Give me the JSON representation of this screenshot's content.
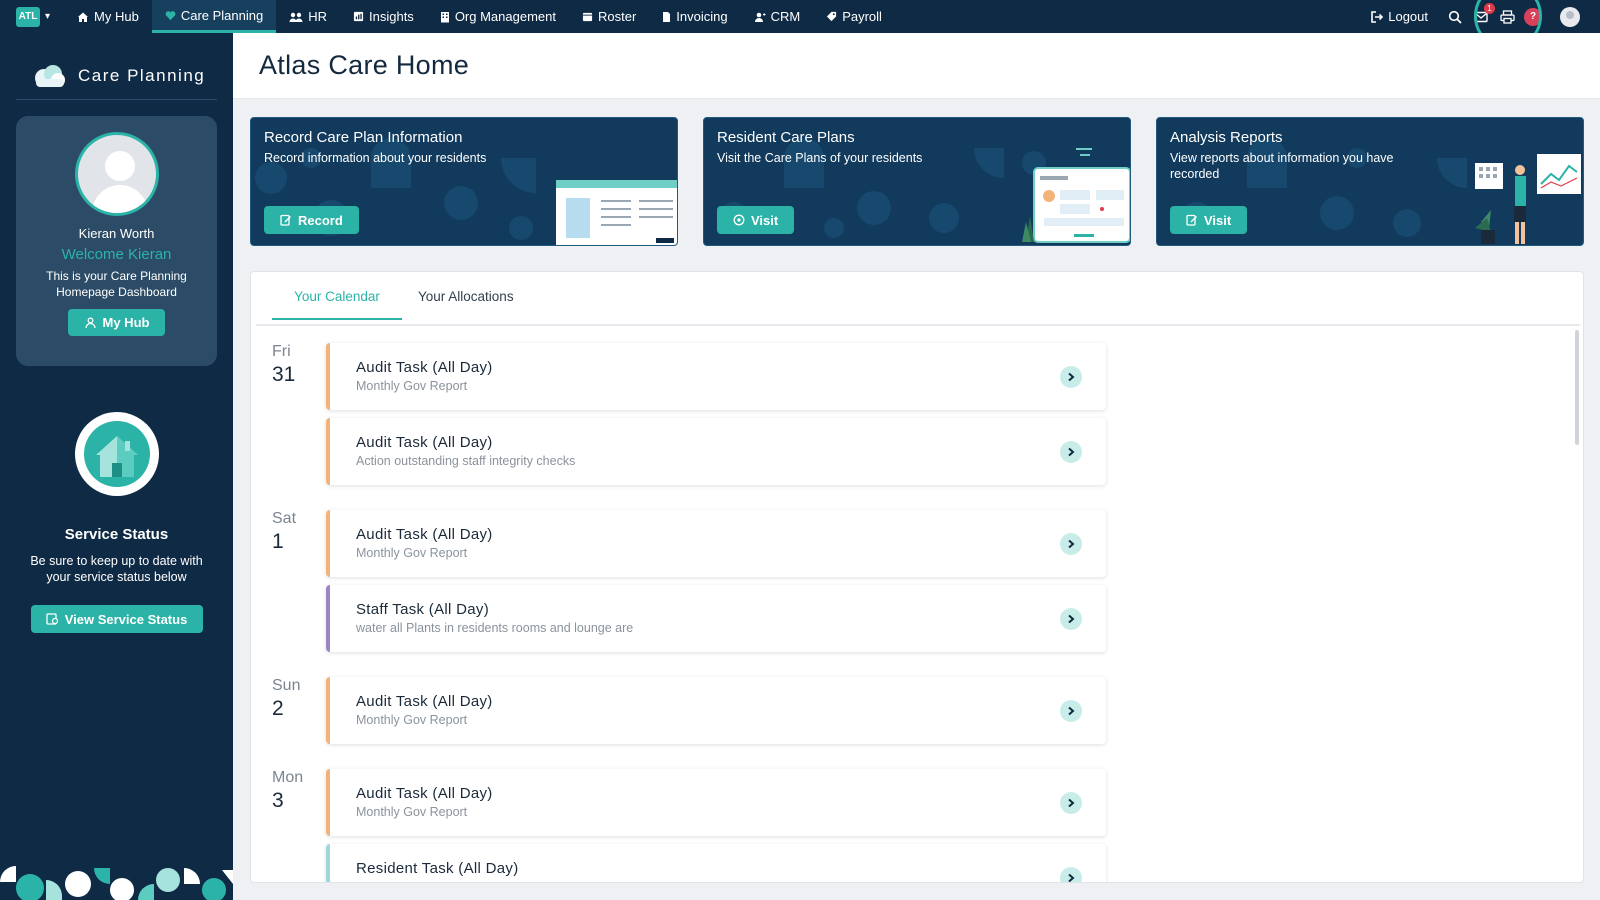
{
  "nav": {
    "brand": "ATL",
    "items": [
      {
        "label": "My Hub",
        "icon": "home-icon"
      },
      {
        "label": "Care Planning",
        "icon": "heart-icon"
      },
      {
        "label": "HR",
        "icon": "people-icon"
      },
      {
        "label": "Insights",
        "icon": "chart-icon"
      },
      {
        "label": "Org Management",
        "icon": "building-icon"
      },
      {
        "label": "Roster",
        "icon": "calendar-icon"
      },
      {
        "label": "Invoicing",
        "icon": "document-icon"
      },
      {
        "label": "CRM",
        "icon": "contacts-icon"
      },
      {
        "label": "Payroll",
        "icon": "tag-icon"
      }
    ],
    "active": "Care Planning",
    "logout": "Logout",
    "mail_badge": "1",
    "help": "?"
  },
  "sidebar": {
    "title": "Care Planning",
    "profile": {
      "name": "Kieran Worth",
      "welcome": "Welcome Kieran",
      "description": "This is your Care Planning Homepage Dashboard",
      "button": "My Hub"
    },
    "status": {
      "title": "Service Status",
      "description": "Be sure to keep up to date with your service status below",
      "button": "View Service Status"
    }
  },
  "header": {
    "title": "Atlas Care Home"
  },
  "banners": [
    {
      "title": "Record Care Plan Information",
      "subtitle": "Record information about your residents",
      "button": "Record"
    },
    {
      "title": "Resident Care Plans",
      "subtitle": "Visit the Care Plans of your residents",
      "button": "Visit"
    },
    {
      "title": "Analysis Reports",
      "subtitle": "View reports about information you have recorded",
      "button": "Visit"
    }
  ],
  "tabs": [
    {
      "label": "Your Calendar",
      "active": true
    },
    {
      "label": "Your Allocations",
      "active": false
    }
  ],
  "calendar": [
    {
      "day": "Fri",
      "date": "31",
      "events": [
        {
          "title": "Audit Task (All Day)",
          "subtitle": "Monthly Gov Report",
          "type": "audit"
        },
        {
          "title": "Audit Task (All Day)",
          "subtitle": "Action outstanding staff integrity checks",
          "type": "audit"
        }
      ]
    },
    {
      "day": "Sat",
      "date": "1",
      "events": [
        {
          "title": "Audit Task (All Day)",
          "subtitle": "Monthly Gov Report",
          "type": "audit"
        },
        {
          "title": "Staff Task (All Day)",
          "subtitle": "water all Plants in residents rooms and lounge are",
          "type": "staff"
        }
      ]
    },
    {
      "day": "Sun",
      "date": "2",
      "events": [
        {
          "title": "Audit Task (All Day)",
          "subtitle": "Monthly Gov Report",
          "type": "audit"
        }
      ]
    },
    {
      "day": "Mon",
      "date": "3",
      "events": [
        {
          "title": "Audit Task (All Day)",
          "subtitle": "Monthly Gov Report",
          "type": "audit"
        },
        {
          "title": "Resident Task (All Day)",
          "subtitle": "",
          "type": "resident"
        }
      ]
    }
  ],
  "colors": {
    "navy": "#0f2a44",
    "teal": "#2bb3a7",
    "audit_border": "#f2b27a",
    "staff_border": "#9b86c2",
    "resident_border": "#9fd8dc"
  }
}
